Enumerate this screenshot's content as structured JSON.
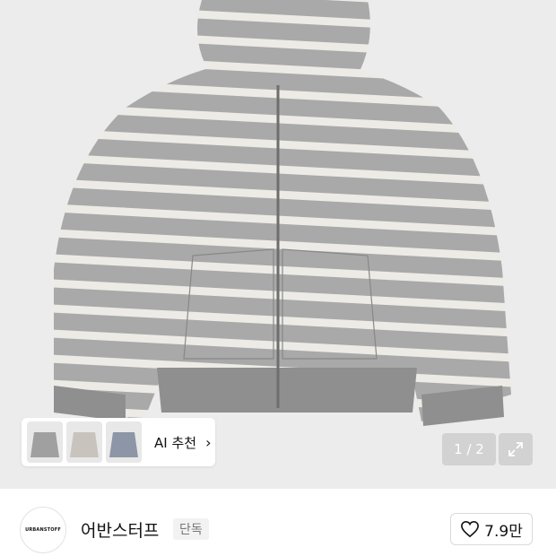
{
  "product": {
    "image_alt": "striped zip-up hoodie",
    "page_counter": "1 / 2"
  },
  "ai_recommend": {
    "label": "AI 추천",
    "chevron_icon": "chevron-right-icon",
    "thumbnails": [
      "grey-hoodie-thumb",
      "beige-hoodie-thumb",
      "blue-hoodie-thumb"
    ]
  },
  "brand": {
    "logo_text": "URBANSTOFF",
    "name": "어반스터프",
    "badge": "단독"
  },
  "like": {
    "icon": "heart-icon",
    "count": "7.9만"
  },
  "colors": {
    "image_bg": "#ececec",
    "stripe_grey": "#a9a9a9",
    "stripe_white": "#ecebe6"
  }
}
